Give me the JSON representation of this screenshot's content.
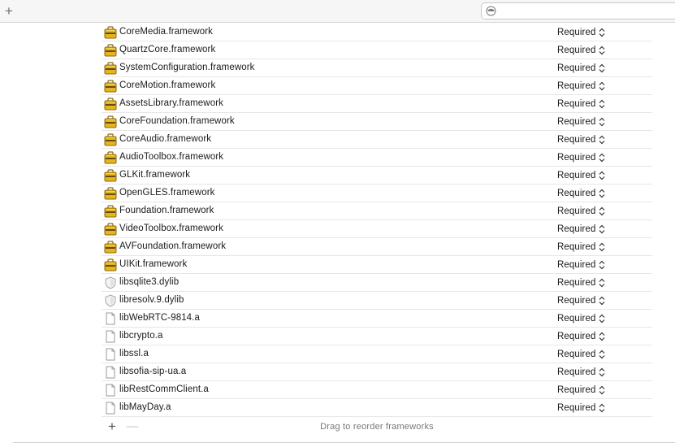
{
  "toolbar": {
    "add_icon": "plus-icon",
    "search": {
      "value": "",
      "placeholder": "",
      "icon": "filter-icon"
    }
  },
  "frameworks": [
    {
      "name": "CoreMedia.framework",
      "status": "Required",
      "icon": "framework-toolbox-icon"
    },
    {
      "name": "QuartzCore.framework",
      "status": "Required",
      "icon": "framework-toolbox-icon"
    },
    {
      "name": "SystemConfiguration.framework",
      "status": "Required",
      "icon": "framework-toolbox-icon"
    },
    {
      "name": "CoreMotion.framework",
      "status": "Required",
      "icon": "framework-toolbox-icon"
    },
    {
      "name": "AssetsLibrary.framework",
      "status": "Required",
      "icon": "framework-toolbox-icon"
    },
    {
      "name": "CoreFoundation.framework",
      "status": "Required",
      "icon": "framework-toolbox-icon"
    },
    {
      "name": "CoreAudio.framework",
      "status": "Required",
      "icon": "framework-toolbox-icon"
    },
    {
      "name": "AudioToolbox.framework",
      "status": "Required",
      "icon": "framework-toolbox-icon"
    },
    {
      "name": "GLKit.framework",
      "status": "Required",
      "icon": "framework-toolbox-icon"
    },
    {
      "name": "OpenGLES.framework",
      "status": "Required",
      "icon": "framework-toolbox-icon"
    },
    {
      "name": "Foundation.framework",
      "status": "Required",
      "icon": "framework-toolbox-icon"
    },
    {
      "name": "VideoToolbox.framework",
      "status": "Required",
      "icon": "framework-toolbox-icon"
    },
    {
      "name": "AVFoundation.framework",
      "status": "Required",
      "icon": "framework-toolbox-icon"
    },
    {
      "name": "UIKit.framework",
      "status": "Required",
      "icon": "framework-toolbox-icon"
    },
    {
      "name": "libsqlite3.dylib",
      "status": "Required",
      "icon": "dylib-shield-icon"
    },
    {
      "name": "libresolv.9.dylib",
      "status": "Required",
      "icon": "dylib-shield-icon"
    },
    {
      "name": "libWebRTC-9814.a",
      "status": "Required",
      "icon": "static-library-file-icon"
    },
    {
      "name": "libcrypto.a",
      "status": "Required",
      "icon": "static-library-file-icon"
    },
    {
      "name": "libssl.a",
      "status": "Required",
      "icon": "static-library-file-icon"
    },
    {
      "name": "libsofia-sip-ua.a",
      "status": "Required",
      "icon": "static-library-file-icon"
    },
    {
      "name": "libRestCommClient.a",
      "status": "Required",
      "icon": "static-library-file-icon"
    },
    {
      "name": "libMayDay.a",
      "status": "Required",
      "icon": "static-library-file-icon"
    }
  ],
  "footer": {
    "add_icon": "plus-icon",
    "remove_icon": "minus-icon",
    "hint": "Drag to reorder frameworks"
  },
  "colors": {
    "framework_icon": "#e8b41c",
    "framework_icon_dark": "#8a6a0c",
    "row_divider": "#e6e6e6",
    "hint_text": "#777777"
  }
}
